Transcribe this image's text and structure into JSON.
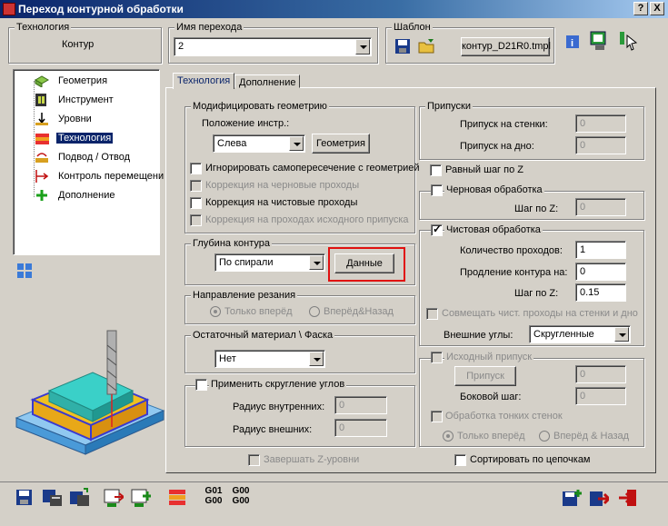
{
  "window": {
    "title": "Переход контурной обработки",
    "help_btn": "?",
    "close_btn": "X"
  },
  "header": {
    "technology_label": "Технология",
    "technology_value": "Контур",
    "name_label": "Имя перехода",
    "name_value": "2",
    "template_label": "Шаблон",
    "template_value": "контур_D21R0.tmpl"
  },
  "tree": {
    "items": [
      {
        "label": "Геометрия",
        "icon": "geometry-icon"
      },
      {
        "label": "Инструмент",
        "icon": "tool-icon"
      },
      {
        "label": "Уровни",
        "icon": "levels-icon"
      },
      {
        "label": "Технология",
        "icon": "technology-icon",
        "selected": true
      },
      {
        "label": "Подвод / Отвод",
        "icon": "approach-icon"
      },
      {
        "label": "Контроль перемещени",
        "icon": "motion-control-icon"
      },
      {
        "label": "Дополнение",
        "icon": "addition-icon"
      }
    ]
  },
  "tabs": {
    "active": "Технология",
    "other": "Дополнение"
  },
  "modify_geometry": {
    "title": "Модифицировать геометрию",
    "tool_pos_label": "Положение инстр.:",
    "tool_pos_value": "Слева",
    "geometry_btn": "Геометрия",
    "ignore_self": "Игнорировать самопересечение с геометрией",
    "corr_rough": "Коррекция на черновые проходы",
    "corr_finish": "Коррекция на чистовые проходы",
    "corr_stock": "Коррекция на проходах исходного припуска"
  },
  "depth": {
    "title": "Глубина контура",
    "value": "По спирали",
    "data_btn": "Данные"
  },
  "cut_dir": {
    "title": "Направление резания",
    "opt1": "Только вперёд",
    "opt2": "Вперёд&Назад"
  },
  "residual": {
    "title": "Остаточный материал \\ Фаска",
    "value": "Нет"
  },
  "rounding": {
    "title": "Применить скругление углов",
    "inner_label": "Радиус внутренних:",
    "inner_value": "0",
    "outer_label": "Радиус внешних:",
    "outer_value": "0"
  },
  "finish_z": "Завершать Z-уровни",
  "stock": {
    "title": "Припуски",
    "wall_label": "Припуск на стенки:",
    "wall_value": "0",
    "floor_label": "Припуск на дно:",
    "floor_value": "0"
  },
  "equal_z": "Равный шаг по Z",
  "rough": {
    "title": "Черновая обработка",
    "z_label": "Шаг по Z:",
    "z_value": "0"
  },
  "finish": {
    "title": "Чистовая обработка",
    "passes_label": "Количество проходов:",
    "passes_value": "1",
    "extend_label": "Продление контура на:",
    "extend_value": "0",
    "z_label": "Шаг по Z:",
    "z_value": "0.15",
    "combine": "Совмещать чист. проходы на стенки и дно",
    "corners_label": "Внешние углы:",
    "corners_value": "Скругленные"
  },
  "source_stock": {
    "title": "Исходный припуск",
    "stock_btn": "Припуск",
    "stock_value": "0",
    "side_label": "Боковой шаг:",
    "side_value": "0",
    "thin_walls": "Обработка тонких стенок",
    "opt1": "Только вперёд",
    "opt2": "Вперёд & Назад"
  },
  "sort_chains": "Сортировать по цепочкам",
  "bottom": {
    "g01": "G01",
    "g00": "G00",
    "g00b": "G00",
    "g00c": "G00"
  }
}
